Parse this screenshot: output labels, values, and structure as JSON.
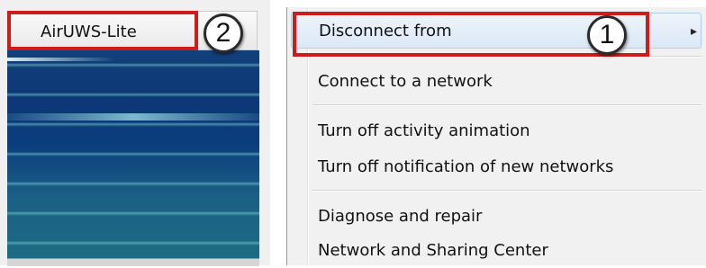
{
  "network_submenu": {
    "network_name": "AirUWS-Lite"
  },
  "context_menu": {
    "items": [
      {
        "label": "Disconnect from",
        "has_submenu": true,
        "highlighted": true
      },
      {
        "label": "Connect to a network"
      },
      {
        "label": "Turn off activity animation"
      },
      {
        "label": "Turn off notification of new networks"
      },
      {
        "label": "Diagnose and repair"
      },
      {
        "label": "Network and Sharing Center"
      }
    ],
    "submenu_arrow_icon": "triangle-right-icon"
  },
  "annotations": {
    "callout_1": "1",
    "callout_2": "2",
    "box_color": "#cc1c1c"
  }
}
